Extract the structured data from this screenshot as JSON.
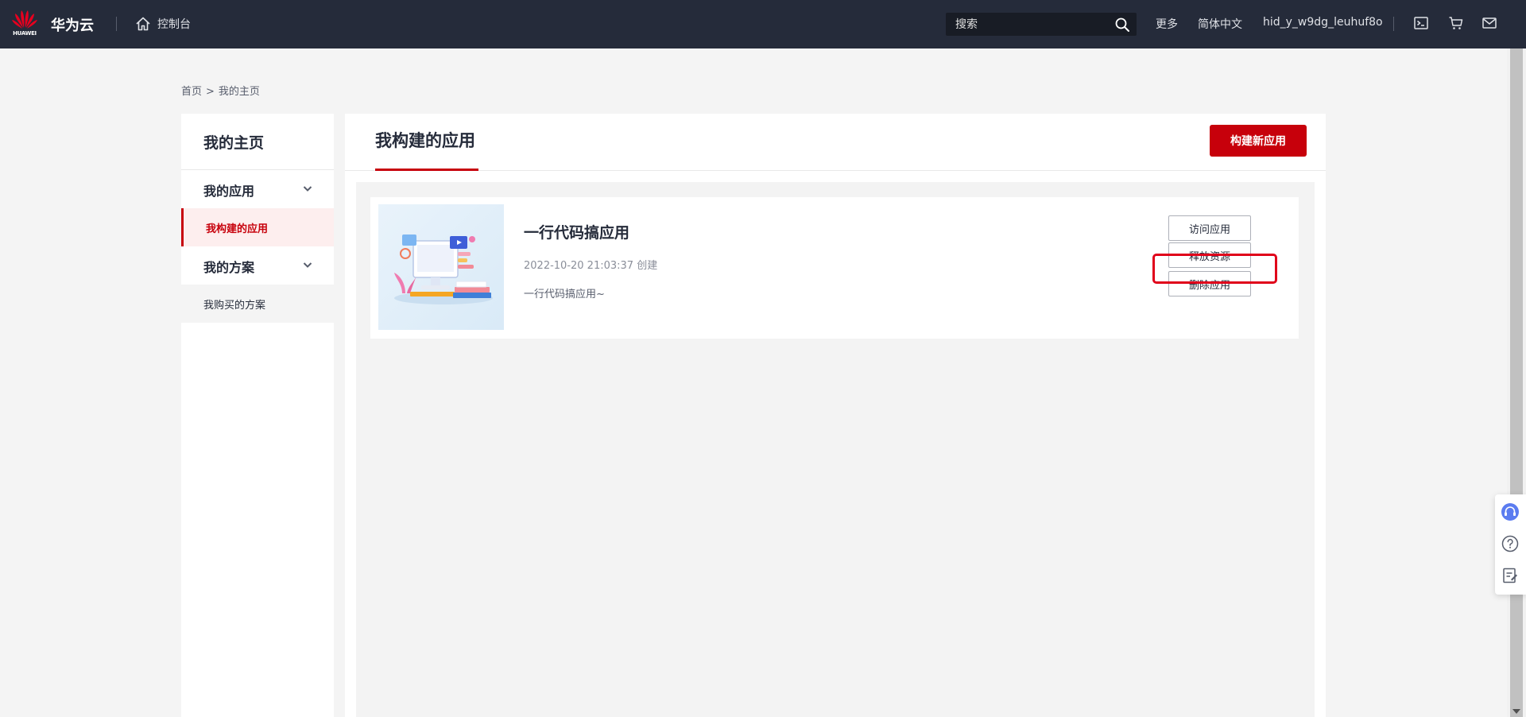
{
  "header": {
    "logo_text": "HUAWEI",
    "brand": "华为云",
    "console_label": "控制台",
    "search_placeholder": "搜索",
    "more": "更多",
    "language": "简体中文",
    "username": "hid_y_w9dg_leuhuf8o",
    "icons": [
      "terminal-icon",
      "cart-icon",
      "mail-icon"
    ]
  },
  "breadcrumb": {
    "home": "首页",
    "separator": ">",
    "current": "我的主页"
  },
  "sidebar": {
    "title": "我的主页",
    "groups": [
      {
        "label": "我的应用",
        "items": [
          {
            "label": "我构建的应用",
            "active": true
          }
        ]
      },
      {
        "label": "我的方案",
        "items": [
          {
            "label": "我购买的方案",
            "active": false
          }
        ]
      }
    ]
  },
  "main": {
    "title": "我构建的应用",
    "new_app_button": "构建新应用",
    "apps": [
      {
        "name": "一行代码搞应用",
        "created": "2022-10-20 21:03:37 创建",
        "description": "一行代码搞应用~",
        "actions": [
          "访问应用",
          "释放资源",
          "删除应用"
        ]
      }
    ]
  },
  "floating_tools": [
    "headset-icon",
    "help-icon",
    "feedback-icon"
  ],
  "colors": {
    "header_bg": "#252b3a",
    "accent": "#c7000b",
    "highlight": "#e0001a",
    "page_bg": "#f4f4f4"
  }
}
